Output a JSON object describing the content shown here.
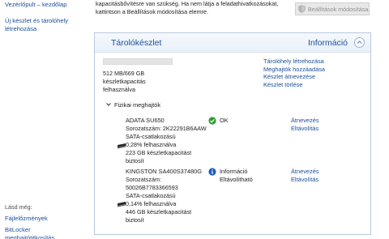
{
  "sidebar": {
    "home_link": "Vezérlőpult – kezdőlap",
    "new_pool_link_line1": "Új készlet és tárolóhely",
    "new_pool_link_line2": "létrehozása",
    "see_also": "Lásd még:",
    "file_history": "Fájlelőzmények",
    "bitlocker": "BitLocker meghajtótitkosítás"
  },
  "intro": {
    "line1": "kapacitásbővítésre van szükség. Ha nem látja a feladathivatkozásokat,",
    "line2": "kattintson a Beállítások módosítása elemre."
  },
  "toolbar": {
    "change_settings": "Beállítások módosítása",
    "change_settings_icon": "shield-icon"
  },
  "panel": {
    "title": "Tárolókészlet",
    "info": "Információ",
    "collapse_icon": "chevron-up-icon",
    "usage_fraction": 0.0,
    "usage_line1": "512 MB/669 GB",
    "usage_line2": "készletkapacitás",
    "usage_line3": "felhasználva",
    "links": [
      "Tárolóhely létrehozása",
      "Meghajtók hozzáadása",
      "Készlet átnevezése",
      "Készlet törlése"
    ],
    "section_title": "Fizikai meghajtók"
  },
  "disks": [
    {
      "name": "ADATA SU650",
      "serial": "Sorozatszám: 2K22291B6AAW",
      "bus": "SATA-csatlakozású",
      "used": "0,28% felhasználva",
      "capacity_line1": "223 GB készletkapacitást",
      "capacity_line2": "biztosít",
      "status_icon": "ok-check-icon",
      "status_line1": "OK",
      "status_line2": "",
      "rename": "Átnevezés",
      "remove": "Eltávolítás"
    },
    {
      "name": "KINGSTON SA400S37480G",
      "serial_line1": "Sorozatszám:",
      "serial_line2": "50026B7783366593",
      "bus": "SATA-csatlakozású",
      "used": "0,14% felhasználva",
      "capacity_line1": "446 GB készletkapacitást",
      "capacity_line2": "biztosít",
      "status_icon": "info-icon",
      "status_line1": "Információ",
      "status_line2": "Eltávolítható",
      "rename": "Átnevezés",
      "remove": "Eltávolítás"
    }
  ],
  "colors": {
    "link": "#1a4f9c",
    "ok_green": "#2e9b2e",
    "info_blue": "#1f5fbf"
  }
}
